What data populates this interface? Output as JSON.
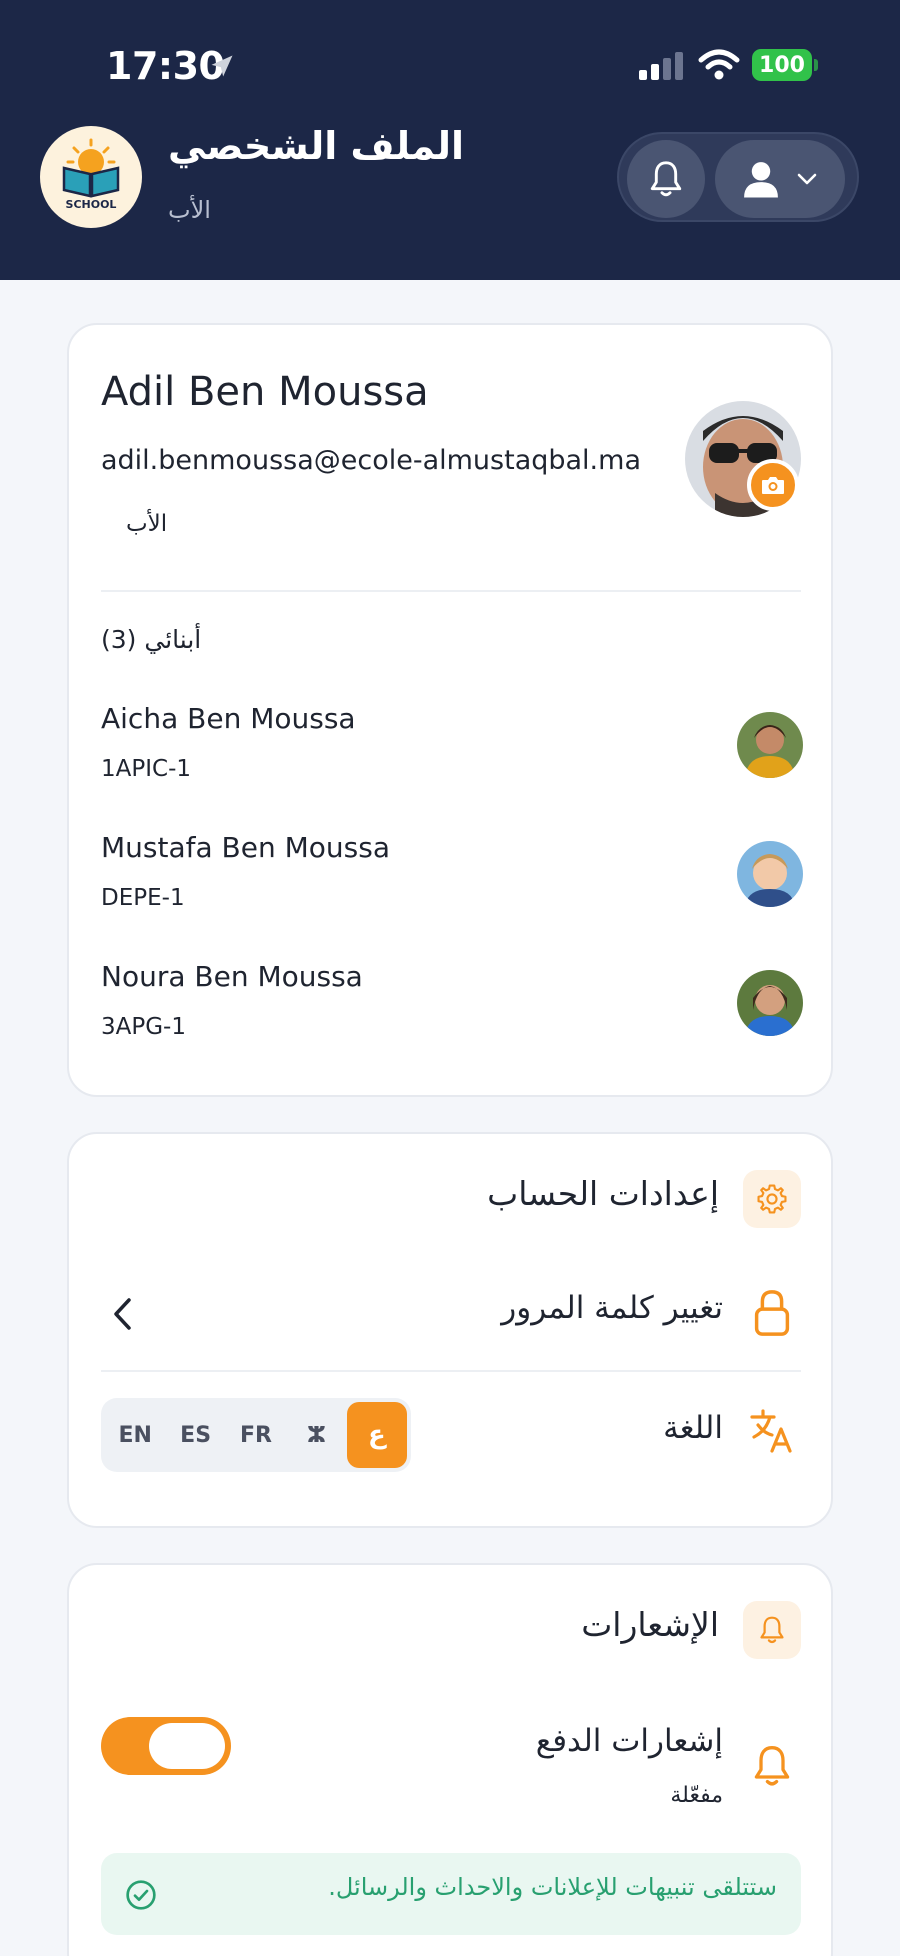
{
  "status_bar": {
    "time": "17:30",
    "battery": "100"
  },
  "header": {
    "logo_text": "SCHOOL",
    "title": "الملف الشخصي",
    "subtitle": "الأب"
  },
  "profile": {
    "name": "Adil Ben Moussa",
    "email": "adil.benmoussa@ecole-almustaqbal.ma",
    "role": "الأب"
  },
  "children": {
    "title": "أبنائي (3)",
    "items": [
      {
        "name": "Aicha Ben Moussa",
        "class": "1APIC-1"
      },
      {
        "name": "Mustafa Ben Moussa",
        "class": "DEPE-1"
      },
      {
        "name": "Noura Ben Moussa",
        "class": "3APG-1"
      }
    ]
  },
  "account_settings": {
    "title": "إعدادات الحساب",
    "change_password": "تغيير كلمة المرور",
    "language_label": "اللغة",
    "languages": [
      "EN",
      "ES",
      "FR",
      "ⵣ",
      "ع"
    ],
    "selected_language": "ع"
  },
  "notifications": {
    "title": "الإشعارات",
    "push_label": "إشعارات الدفع",
    "push_status": "مفعّلة",
    "push_enabled": true,
    "info": "ستتلقى تنبيهات للإعلانات والاحداث والرسائل."
  },
  "colors": {
    "header_bg": "#1c2747",
    "accent": "#f5921f",
    "success": "#28a070"
  }
}
